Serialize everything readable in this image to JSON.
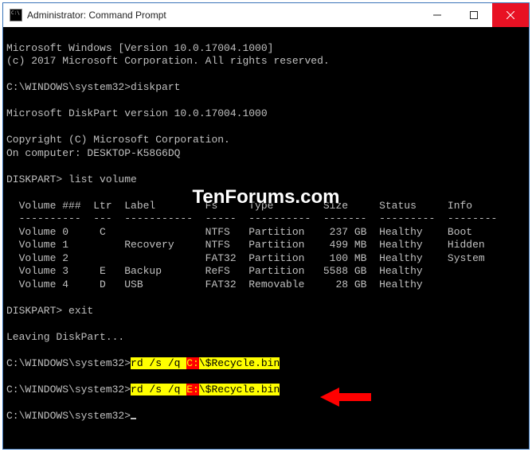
{
  "window": {
    "title": "Administrator: Command Prompt"
  },
  "watermark": "TenForums.com",
  "lines": {
    "ms_windows": "Microsoft Windows [Version 10.0.17004.1000]",
    "copyright": "(c) 2017 Microsoft Corporation. All rights reserved.",
    "blank": "",
    "prompt1_path": "C:\\WINDOWS\\system32>",
    "prompt1_cmd": "diskpart",
    "dp_version": "Microsoft DiskPart version 10.0.17004.1000",
    "dp_copy": "Copyright (C) Microsoft Corporation.",
    "dp_computer": "On computer: DESKTOP-K58G6DQ",
    "dp_prompt1": "DISKPART> ",
    "dp_cmd1": "list volume",
    "header": "  Volume ###  Ltr  Label        Fs     Type        Size     Status     Info",
    "divider": "  ----------  ---  -----------  -----  ----------  -------  ---------  --------",
    "vol0": "  Volume 0     C                NTFS   Partition    237 GB  Healthy    Boot",
    "vol1": "  Volume 1         Recovery     NTFS   Partition    499 MB  Healthy    Hidden",
    "vol2": "  Volume 2                      FAT32  Partition    100 MB  Healthy    System",
    "vol3": "  Volume 3     E   Backup       ReFS   Partition   5588 GB  Healthy",
    "vol4": "  Volume 4     D   USB          FAT32  Removable     28 GB  Healthy",
    "dp_prompt2": "DISKPART> ",
    "dp_cmd2": "exit",
    "leaving": "Leaving DiskPart...",
    "prompt2_path": "C:\\WINDOWS\\system32>",
    "rd_cmd": "rd /s /q ",
    "drive_c": "C:",
    "drive_e": "E:",
    "recycle": "\\$Recycle.bin",
    "prompt3_path": "C:\\WINDOWS\\system32>"
  },
  "chart_data": {
    "type": "table",
    "title": "DISKPART list volume",
    "columns": [
      "Volume ###",
      "Ltr",
      "Label",
      "Fs",
      "Type",
      "Size",
      "Status",
      "Info"
    ],
    "rows": [
      [
        "Volume 0",
        "C",
        "",
        "NTFS",
        "Partition",
        "237 GB",
        "Healthy",
        "Boot"
      ],
      [
        "Volume 1",
        "",
        "Recovery",
        "NTFS",
        "Partition",
        "499 MB",
        "Healthy",
        "Hidden"
      ],
      [
        "Volume 2",
        "",
        "",
        "FAT32",
        "Partition",
        "100 MB",
        "Healthy",
        "System"
      ],
      [
        "Volume 3",
        "E",
        "Backup",
        "ReFS",
        "Partition",
        "5588 GB",
        "Healthy",
        ""
      ],
      [
        "Volume 4",
        "D",
        "USB",
        "FAT32",
        "Removable",
        "28 GB",
        "Healthy",
        ""
      ]
    ]
  }
}
